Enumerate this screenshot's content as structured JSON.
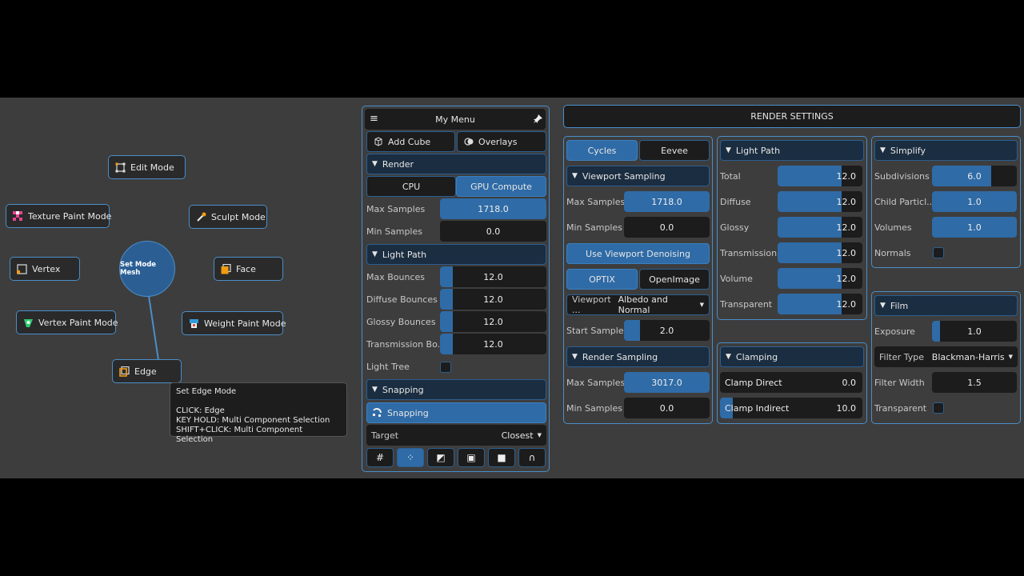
{
  "pie_menu": {
    "center_label": "Set Mode Mesh",
    "items": {
      "edit_mode": "Edit Mode",
      "texture_paint_mode": "Texture Paint Mode",
      "sculpt_mode": "Sculpt Mode",
      "vertex": "Vertex",
      "face": "Face",
      "vertex_paint_mode": "Vertex Paint Mode",
      "weight_paint_mode": "Weight Paint Mode",
      "edge": "Edge"
    },
    "tooltip": {
      "title": "Set Edge Mode",
      "line1": "CLICK: Edge",
      "line2": "KEY HOLD: Multi Component Selection",
      "line3": "SHIFT+CLICK: Multi Component Selection"
    }
  },
  "my_menu": {
    "title": "My Menu",
    "add_cube": "Add Cube",
    "overlays": "Overlays",
    "render_header": "Render",
    "cpu": "CPU",
    "gpu_compute": "GPU Compute",
    "max_samples_label": "Max Samples",
    "max_samples_value": "1718.0",
    "max_samples_fill": 1.0,
    "min_samples_label": "Min Samples",
    "min_samples_value": "0.0",
    "light_path_header": "Light Path",
    "max_bounces_label": "Max Bounces",
    "max_bounces_value": "12.0",
    "diffuse_bounces_label": "Diffuse Bounces",
    "diffuse_bounces_value": "12.0",
    "glossy_bounces_label": "Glossy Bounces",
    "glossy_bounces_value": "12.0",
    "transmission_bounces_label": "Transmission Bo...",
    "transmission_bounces_value": "12.0",
    "light_tree_label": "Light Tree",
    "snapping_header": "Snapping",
    "snapping_button": "Snapping",
    "target_label": "Target",
    "target_value": "Closest"
  },
  "render_settings": {
    "title": "RENDER SETTINGS",
    "col1": {
      "cycles": "Cycles",
      "eevee": "Eevee",
      "viewport_sampling_header": "Viewport Sampling",
      "max_samples_label": "Max Samples",
      "max_samples_value": "1718.0",
      "min_samples_label": "Min Samples",
      "min_samples_value": "0.0",
      "use_viewport_denoising": "Use Viewport Denoising",
      "optix": "OPTIX",
      "openimage": "OpenImage",
      "viewport_dd_label": "Viewport ...",
      "viewport_dd_value": "Albedo and Normal",
      "start_sample_label": "Start Sample",
      "start_sample_value": "2.0",
      "render_sampling_header": "Render Sampling",
      "r_max_samples_label": "Max Samples",
      "r_max_samples_value": "3017.0",
      "r_min_samples_label": "Min Samples",
      "r_min_samples_value": "0.0"
    },
    "col2": {
      "light_path_header": "Light Path",
      "total_label": "Total",
      "total_value": "12.0",
      "diffuse_label": "Diffuse",
      "diffuse_value": "12.0",
      "glossy_label": "Glossy",
      "glossy_value": "12.0",
      "transmission_label": "Transmission",
      "transmission_value": "12.0",
      "volume_label": "Volume",
      "volume_value": "12.0",
      "transparent_label": "Transparent",
      "transparent_value": "12.0",
      "clamping_header": "Clamping",
      "clamp_direct_label": "Clamp Direct",
      "clamp_direct_value": "0.0",
      "clamp_indirect_label": "Clamp Indirect",
      "clamp_indirect_value": "10.0"
    },
    "col3": {
      "simplify_header": "Simplify",
      "subdivisions_label": "Subdivisions",
      "subdivisions_value": "6.0",
      "child_particles_label": "Child Particl...",
      "child_particles_value": "1.0",
      "volumes_label": "Volumes",
      "volumes_value": "1.0",
      "normals_label": "Normals",
      "film_header": "Film",
      "exposure_label": "Exposure",
      "exposure_value": "1.0",
      "filter_type_label": "Filter Type",
      "filter_type_value": "Blackman-Harris",
      "filter_width_label": "Filter Width",
      "filter_width_value": "1.5",
      "transparent_label": "Transparent"
    }
  },
  "colors": {
    "accent": "#4a8ec9",
    "fill": "#2f6ba6",
    "field_bg": "#1c1c1c",
    "header_bg": "#1b2d40",
    "background": "#3d3d3d"
  }
}
